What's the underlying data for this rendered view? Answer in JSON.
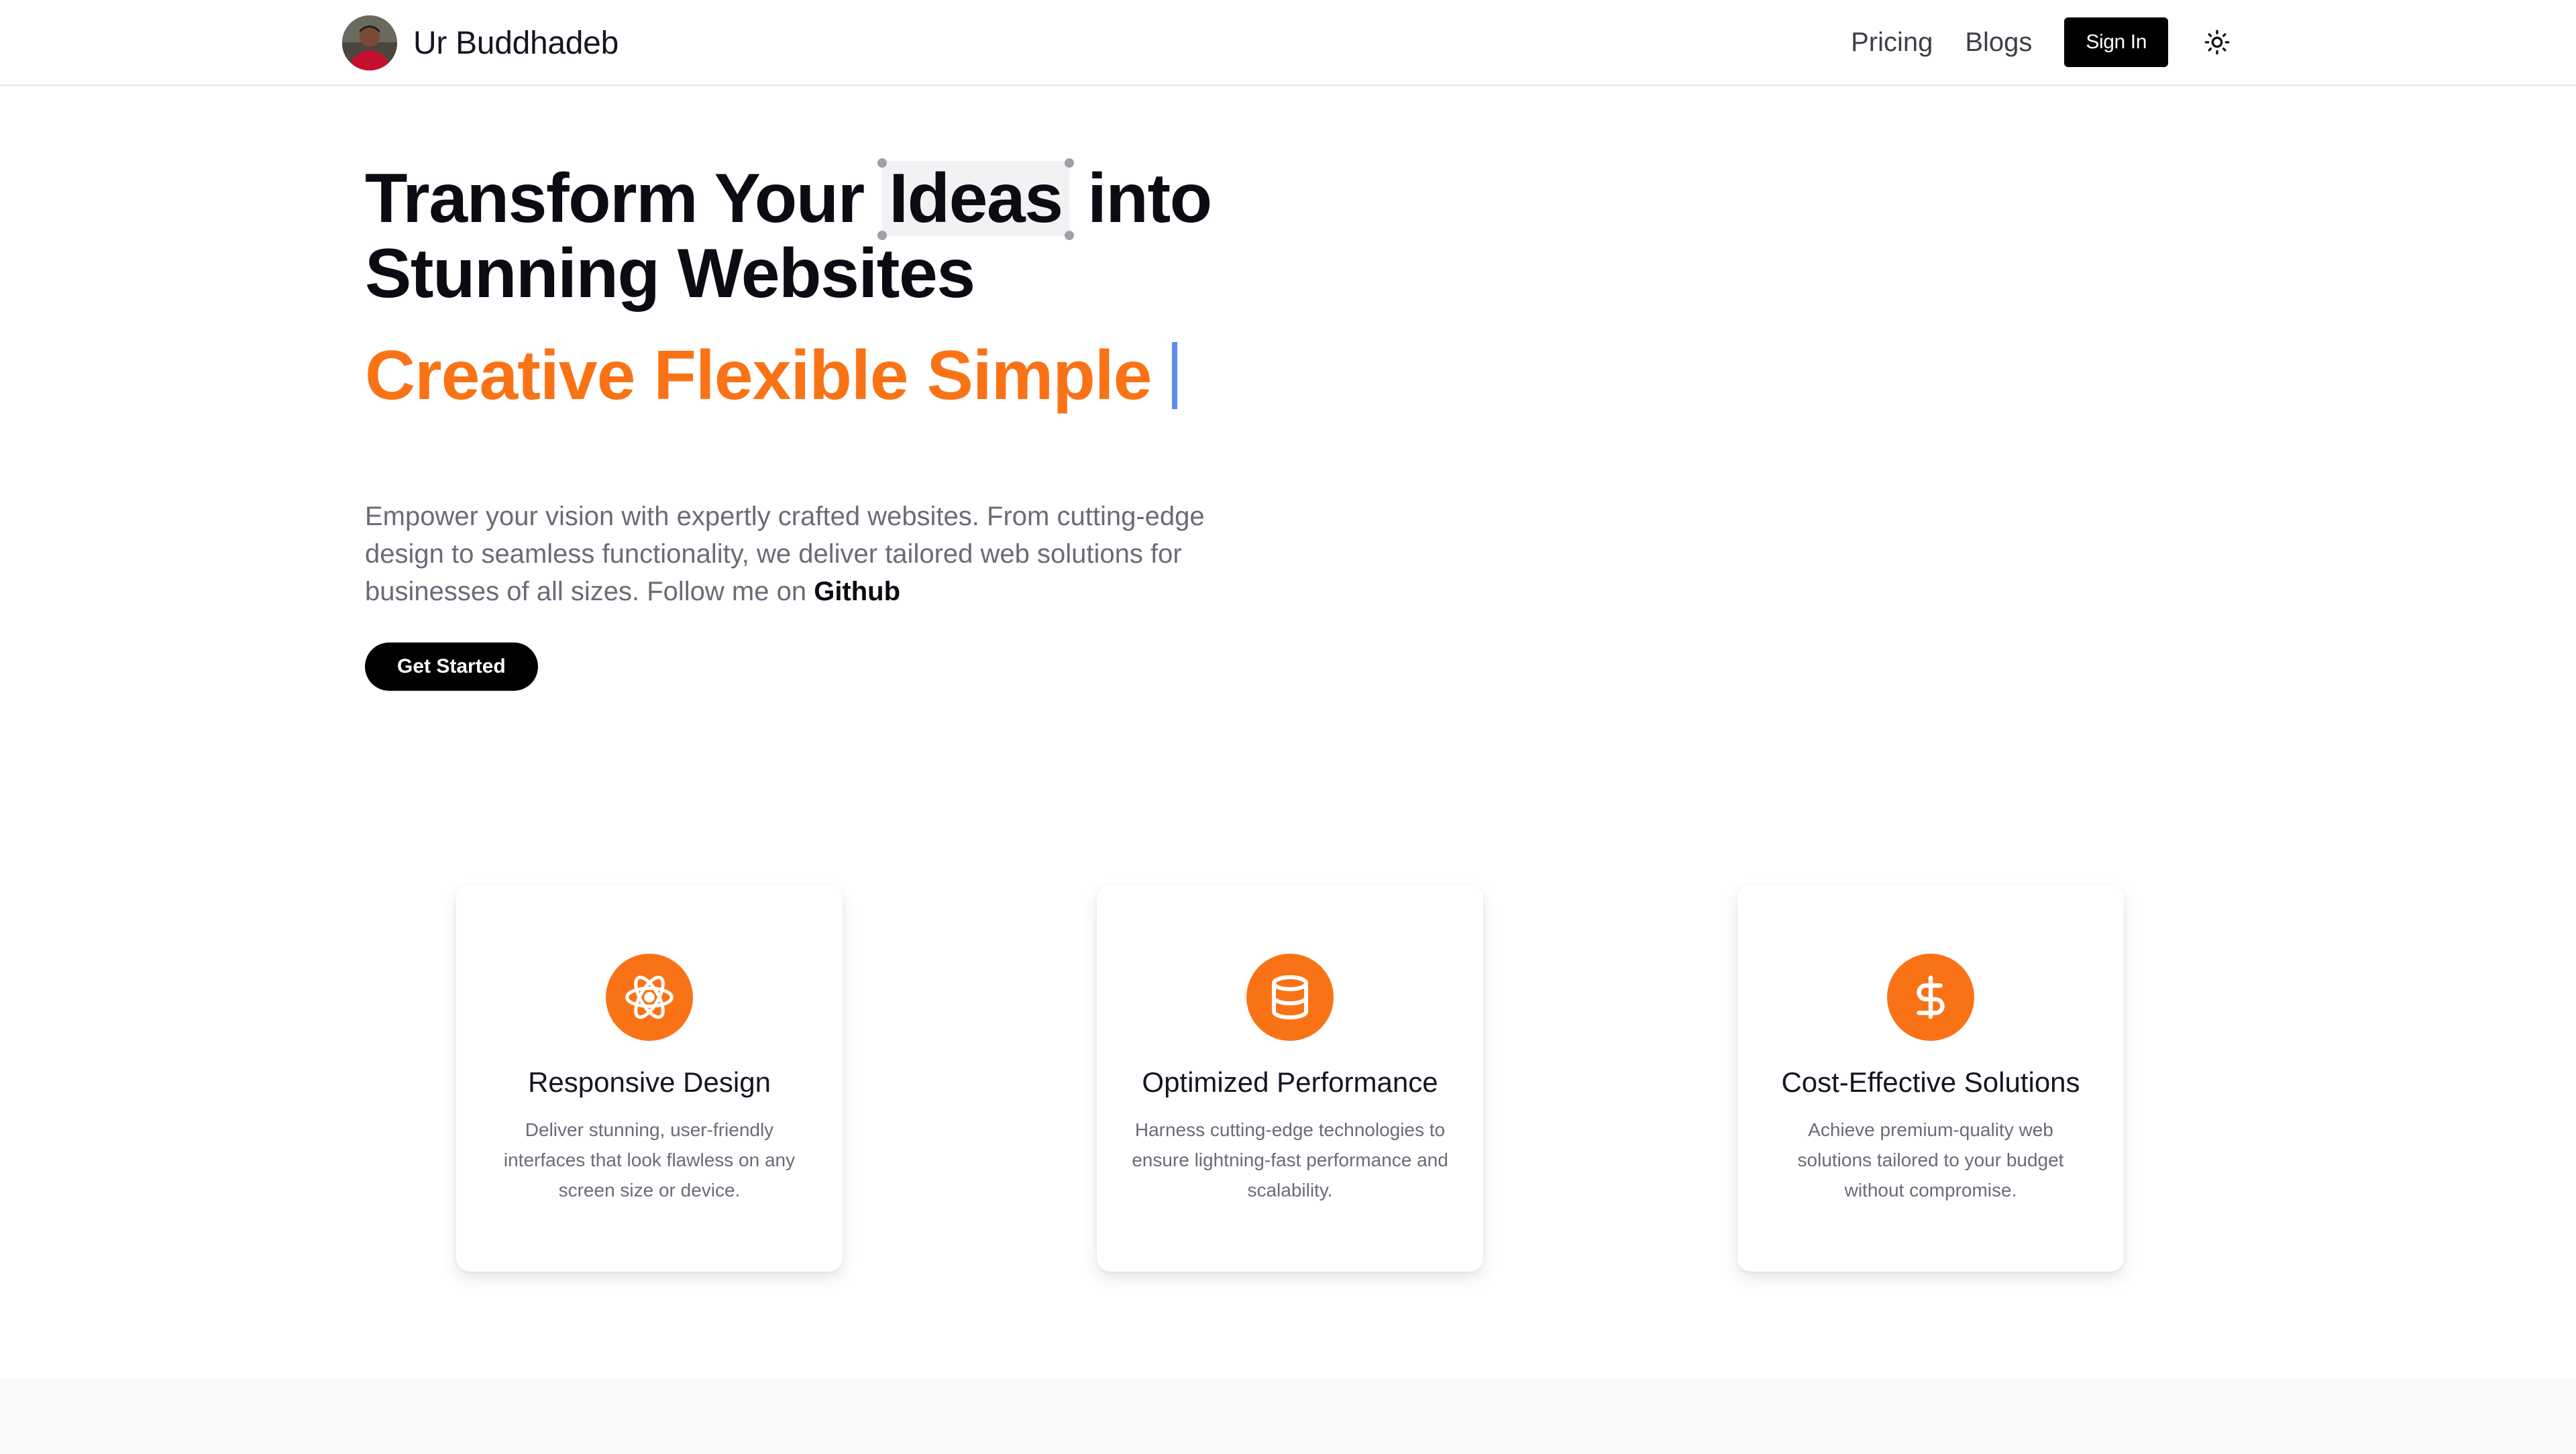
{
  "header": {
    "brand_name": "Ur Buddhadeb",
    "nav": [
      {
        "label": "Pricing"
      },
      {
        "label": "Blogs"
      }
    ],
    "signin_label": "Sign In",
    "theme_icon": "sun-icon"
  },
  "hero": {
    "title_part1": "Transform Your",
    "title_highlight": "Ideas",
    "title_part2": "into",
    "title_line2": "Stunning Websites",
    "tagline": "Creative Flexible Simple",
    "description": "Empower your vision with expertly crafted websites. From cutting-edge design to seamless functionality, we deliver tailored web solutions for businesses of all sizes. Follow me on",
    "github_label": "Github",
    "cta_label": "Get Started"
  },
  "features": [
    {
      "icon": "atom-icon",
      "title": "Responsive Design",
      "desc": "Deliver stunning, user-friendly interfaces that look flawless on any screen size or device."
    },
    {
      "icon": "database-icon",
      "title": "Optimized Performance",
      "desc": "Harness cutting-edge technologies to ensure lightning-fast performance and scalability."
    },
    {
      "icon": "dollar-icon",
      "title": "Cost-Effective Solutions",
      "desc": "Achieve premium-quality web solutions tailored to your budget without compromise."
    }
  ],
  "colors": {
    "accent": "#f97316",
    "caret": "#5b8def",
    "button_bg": "#000000"
  }
}
